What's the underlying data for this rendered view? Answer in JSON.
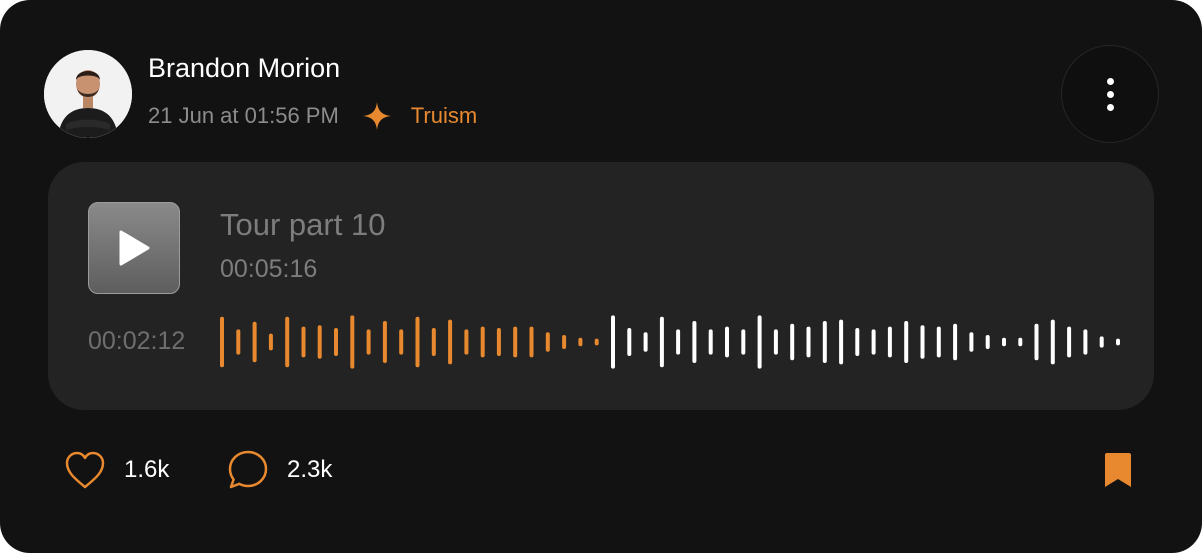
{
  "post": {
    "author": "Brandon Morion",
    "timestamp": "21 Jun at 01:56 PM",
    "category_icon": "sparkle-icon",
    "category": "Truism"
  },
  "player": {
    "title": "Tour part 10",
    "duration": "00:05:16",
    "current_time": "00:02:12",
    "progress": 0.42,
    "waveform_levels": [
      0.9,
      0.45,
      0.72,
      0.3,
      0.9,
      0.55,
      0.6,
      0.5,
      0.95,
      0.45,
      0.75,
      0.45,
      0.9,
      0.5,
      0.8,
      0.45,
      0.55,
      0.5,
      0.55,
      0.55,
      0.35,
      0.25,
      0.15,
      0.12,
      0.95,
      0.5,
      0.35,
      0.9,
      0.45,
      0.75,
      0.45,
      0.55,
      0.45,
      0.95,
      0.45,
      0.65,
      0.55,
      0.75,
      0.8,
      0.5,
      0.45,
      0.55,
      0.75,
      0.6,
      0.55,
      0.65,
      0.35,
      0.25,
      0.15,
      0.15,
      0.65,
      0.8,
      0.55,
      0.45,
      0.2,
      0.12
    ]
  },
  "engagement": {
    "likes": "1.6k",
    "comments": "2.3k"
  },
  "colors": {
    "accent": "#e8892f",
    "played": "#e8892f",
    "unplayed": "#ffffff",
    "card": "#121212",
    "player_bg": "#232323"
  }
}
